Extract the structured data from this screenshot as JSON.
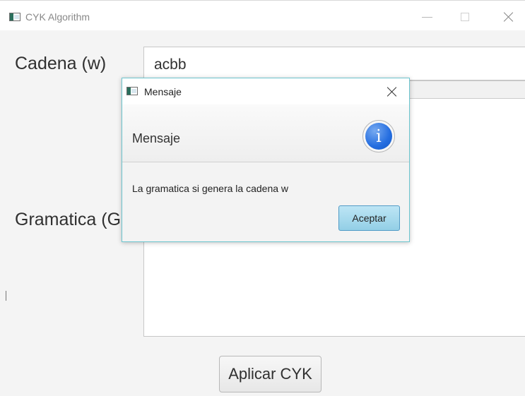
{
  "window": {
    "title": "CYK Algorithm",
    "controls": [
      "minimize-icon",
      "maximize-icon",
      "close-icon"
    ]
  },
  "form": {
    "string_label": "Cadena (w)",
    "string_value": "acbb",
    "grammar_label": "Gramatica (G",
    "apply_button": "Aplicar CYK"
  },
  "dialog": {
    "title": "Mensaje",
    "header": "Mensaje",
    "message": "La gramatica si genera la cadena w",
    "accept_button": "Aceptar",
    "icon": "info-icon",
    "icon_glyph": "i"
  },
  "colors": {
    "dialog_border": "#6dc6cf",
    "accept_button": "#93cfe6",
    "info_icon": "#246de0"
  }
}
